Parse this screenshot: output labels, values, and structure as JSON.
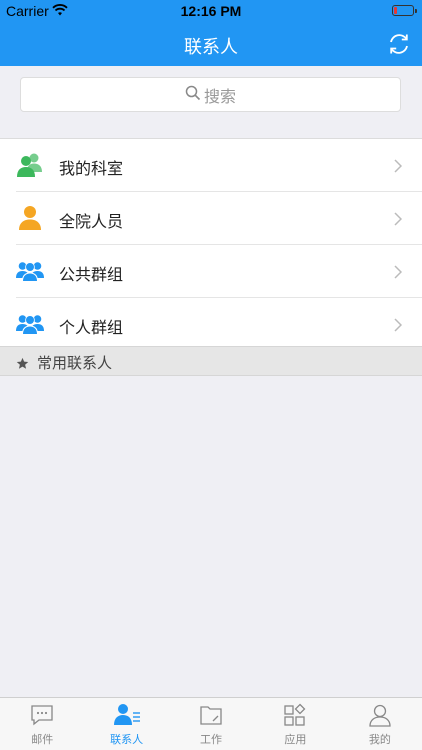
{
  "status": {
    "carrier": "Carrier",
    "time": "12:16 PM"
  },
  "nav": {
    "title": "联系人",
    "refresh_icon": "refresh-icon"
  },
  "search": {
    "placeholder": "搜索"
  },
  "groups": [
    {
      "label": "我的科室",
      "icon": "department-people-icon",
      "color": "#3cb85c"
    },
    {
      "label": "全院人员",
      "icon": "person-icon",
      "color": "#f5a623"
    },
    {
      "label": "公共群组",
      "icon": "group-icon",
      "color": "#2196f3"
    },
    {
      "label": "个人群组",
      "icon": "group-icon",
      "color": "#2196f3"
    }
  ],
  "favorites": {
    "label": "常用联系人",
    "icon": "star-icon"
  },
  "tabs": [
    {
      "label": "邮件",
      "icon": "mail-icon",
      "active": false
    },
    {
      "label": "联系人",
      "icon": "contacts-icon",
      "active": true
    },
    {
      "label": "工作",
      "icon": "work-folder-icon",
      "active": false
    },
    {
      "label": "应用",
      "icon": "apps-icon",
      "active": false
    },
    {
      "label": "我的",
      "icon": "profile-icon",
      "active": false
    }
  ],
  "colors": {
    "accent": "#2196f3",
    "background": "#efeff4"
  }
}
